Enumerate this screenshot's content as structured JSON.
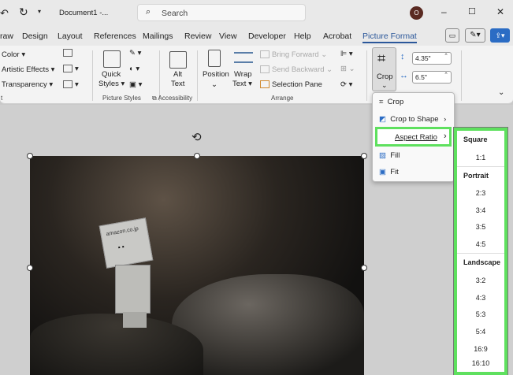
{
  "titlebar": {
    "doc_title": "Document1  -...",
    "search_placeholder": "Search",
    "avatar": "O",
    "minimize": "–",
    "maximize": "☐",
    "close": "✕"
  },
  "tabs": [
    "raw",
    "Design",
    "Layout",
    "References",
    "Mailings",
    "Review",
    "View",
    "Developer",
    "Help",
    "Acrobat",
    "Picture Format"
  ],
  "ribbon": {
    "adjust": {
      "color": "Color",
      "artistic": "Artistic Effects",
      "transparency": "Transparency",
      "group": "t"
    },
    "picture_styles": {
      "quick_styles_1": "Quick",
      "quick_styles_2": "Styles",
      "group": "Picture Styles"
    },
    "accessibility": {
      "alt_1": "Alt",
      "alt_2": "Text",
      "group": "Accessibility"
    },
    "arrange": {
      "position": "Position",
      "wrap_1": "Wrap",
      "wrap_2": "Text",
      "bring_forward": "Bring Forward",
      "send_backward": "Send Backward",
      "selection_pane": "Selection Pane",
      "group": "Arrange"
    },
    "size": {
      "crop": "Crop",
      "height": "4.35\"",
      "width": "6.5\""
    }
  },
  "crop_menu": {
    "items": [
      "Crop",
      "Crop to Shape",
      "Aspect Ratio",
      "Fill",
      "Fit"
    ]
  },
  "aspect_menu": {
    "square_header": "Square",
    "square": [
      "1:1"
    ],
    "portrait_header": "Portrait",
    "portrait": [
      "2:3",
      "3:4",
      "3:5",
      "4:5"
    ],
    "landscape_header": "Landscape",
    "landscape": [
      "3:2",
      "4:3",
      "5:3",
      "5:4",
      "16:9",
      "16:10"
    ]
  },
  "image": {
    "box_text": "amazon.co.jp"
  },
  "colors": {
    "accent": "#2b579a",
    "highlight": "#5ee05e"
  }
}
